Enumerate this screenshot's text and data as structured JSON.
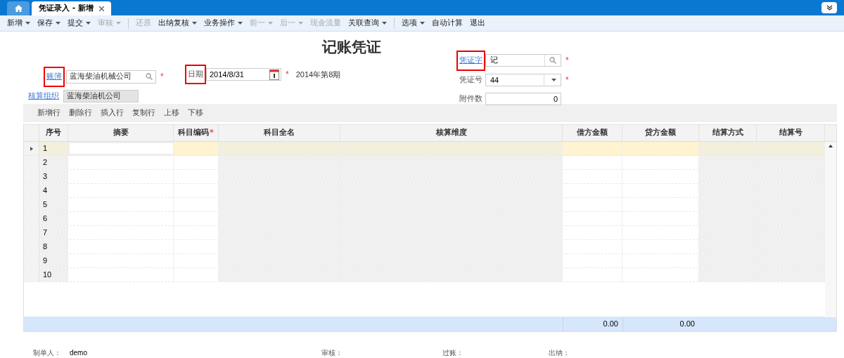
{
  "tabs": [
    {
      "kind": "home",
      "selected": false
    },
    {
      "kind": "page",
      "label": "凭证录入 - 新增",
      "selected": true,
      "closable": true
    }
  ],
  "toolbar": [
    {
      "kind": "button",
      "label": "新增",
      "menu": true,
      "disabled": false
    },
    {
      "kind": "button",
      "label": "保存",
      "menu": true,
      "disabled": false
    },
    {
      "kind": "button",
      "label": "提交",
      "menu": true,
      "disabled": false
    },
    {
      "kind": "button",
      "label": "审核",
      "menu": true,
      "disabled": true
    },
    {
      "kind": "separator"
    },
    {
      "kind": "button",
      "label": "还原",
      "menu": false,
      "disabled": true
    },
    {
      "kind": "button",
      "label": "出纳复核",
      "menu": true,
      "disabled": false
    },
    {
      "kind": "button",
      "label": "业务操作",
      "menu": true,
      "disabled": false
    },
    {
      "kind": "button",
      "label": "前一",
      "menu": true,
      "disabled": true
    },
    {
      "kind": "button",
      "label": "后一",
      "menu": true,
      "disabled": true
    },
    {
      "kind": "button",
      "label": "现金流量",
      "menu": false,
      "disabled": true
    },
    {
      "kind": "button",
      "label": "关联查询",
      "menu": true,
      "disabled": false
    },
    {
      "kind": "separator"
    },
    {
      "kind": "button",
      "label": "选项",
      "menu": true,
      "disabled": false
    },
    {
      "kind": "button",
      "label": "自动计算",
      "menu": false,
      "disabled": false
    },
    {
      "kind": "button",
      "label": "退出",
      "menu": false,
      "disabled": false
    }
  ],
  "form": {
    "title": "记账凭证",
    "book": {
      "label": "账簿",
      "highlighted": true,
      "value": "蓝海柴油机械公司",
      "required": "*"
    },
    "org": {
      "label": "核算组织",
      "value": "蓝海柴油机公司"
    },
    "date": {
      "label": "日期",
      "highlighted": true,
      "value": "2014/8/31",
      "required": "*",
      "period": "2014年第8期"
    },
    "voucher_word": {
      "label": "凭证字",
      "highlighted": true,
      "value": "记",
      "required": "*"
    },
    "voucher_no": {
      "label": "凭证号",
      "value": "44",
      "required": "*"
    },
    "attachments": {
      "label": "附件数",
      "value": "0"
    }
  },
  "grid_toolbar": [
    "新增行",
    "删除行",
    "插入行",
    "复制行",
    "上移",
    "下移"
  ],
  "table": {
    "columns": [
      {
        "label": "序号",
        "shaded": true
      },
      {
        "label": "摘要",
        "shaded": false
      },
      {
        "label": "科目编码",
        "shaded": false,
        "required": "*"
      },
      {
        "label": "科目全名",
        "shaded": true
      },
      {
        "label": "核算维度",
        "shaded": true
      },
      {
        "label": "借方金额",
        "shaded": false
      },
      {
        "label": "贷方金额",
        "shaded": false
      },
      {
        "label": "结算方式",
        "shaded": true
      },
      {
        "label": "结算号",
        "shaded": true
      }
    ],
    "rows": [
      {
        "no": "1",
        "selected": true
      },
      {
        "no": "2",
        "selected": false
      },
      {
        "no": "3",
        "selected": false
      },
      {
        "no": "4",
        "selected": false
      },
      {
        "no": "5",
        "selected": false
      },
      {
        "no": "6",
        "selected": false
      },
      {
        "no": "7",
        "selected": false
      },
      {
        "no": "8",
        "selected": false
      },
      {
        "no": "9",
        "selected": false
      },
      {
        "no": "10",
        "selected": false
      }
    ],
    "totals": {
      "debit": "0.00",
      "credit": "0.00"
    }
  },
  "footer": [
    {
      "label": "制单人：",
      "value": "demo"
    },
    {
      "label": "审核："
    },
    {
      "label": "过账："
    },
    {
      "label": "出纳："
    }
  ]
}
